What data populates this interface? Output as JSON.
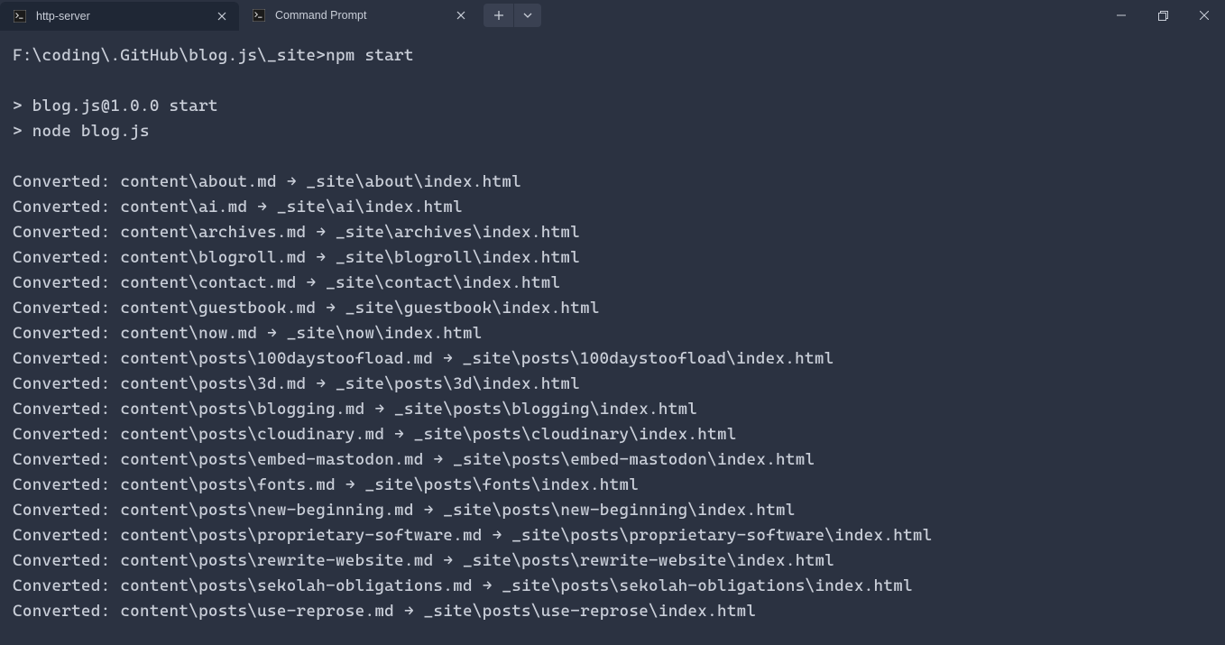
{
  "titlebar": {
    "tabs": [
      {
        "title": "http-server",
        "active": false
      },
      {
        "title": "Command Prompt",
        "active": true
      }
    ],
    "actions": {
      "new_tab_label": "+",
      "dropdown_label": "⌄"
    }
  },
  "terminal": {
    "prompt": "F:\\coding\\.GitHub\\blog.js\\_site>",
    "command": "npm start",
    "script_header": [
      "> blog.js@1.0.0 start",
      "> node blog.js"
    ],
    "conversions": [
      {
        "from": "content\\about.md",
        "to": "_site\\about\\index.html"
      },
      {
        "from": "content\\ai.md",
        "to": "_site\\ai\\index.html"
      },
      {
        "from": "content\\archives.md",
        "to": "_site\\archives\\index.html"
      },
      {
        "from": "content\\blogroll.md",
        "to": "_site\\blogroll\\index.html"
      },
      {
        "from": "content\\contact.md",
        "to": "_site\\contact\\index.html"
      },
      {
        "from": "content\\guestbook.md",
        "to": "_site\\guestbook\\index.html"
      },
      {
        "from": "content\\now.md",
        "to": "_site\\now\\index.html"
      },
      {
        "from": "content\\posts\\100daystooﬂoad.md",
        "to": "_site\\posts\\100daystooﬂoad\\index.html"
      },
      {
        "from": "content\\posts\\3d.md",
        "to": "_site\\posts\\3d\\index.html"
      },
      {
        "from": "content\\posts\\blogging.md",
        "to": "_site\\posts\\blogging\\index.html"
      },
      {
        "from": "content\\posts\\cloudinary.md",
        "to": "_site\\posts\\cloudinary\\index.html"
      },
      {
        "from": "content\\posts\\embed-mastodon.md",
        "to": "_site\\posts\\embed-mastodon\\index.html"
      },
      {
        "from": "content\\posts\\fonts.md",
        "to": "_site\\posts\\fonts\\index.html"
      },
      {
        "from": "content\\posts\\new-beginning.md",
        "to": "_site\\posts\\new-beginning\\index.html"
      },
      {
        "from": "content\\posts\\proprietary-software.md",
        "to": "_site\\posts\\proprietary-software\\index.html"
      },
      {
        "from": "content\\posts\\rewrite-website.md",
        "to": "_site\\posts\\rewrite-website\\index.html"
      },
      {
        "from": "content\\posts\\sekolah-obligations.md",
        "to": "_site\\posts\\sekolah-obligations\\index.html"
      },
      {
        "from": "content\\posts\\use-reprose.md",
        "to": "_site\\posts\\use-reprose\\index.html"
      }
    ],
    "converted_prefix": "Converted: ",
    "arrow": " → "
  }
}
